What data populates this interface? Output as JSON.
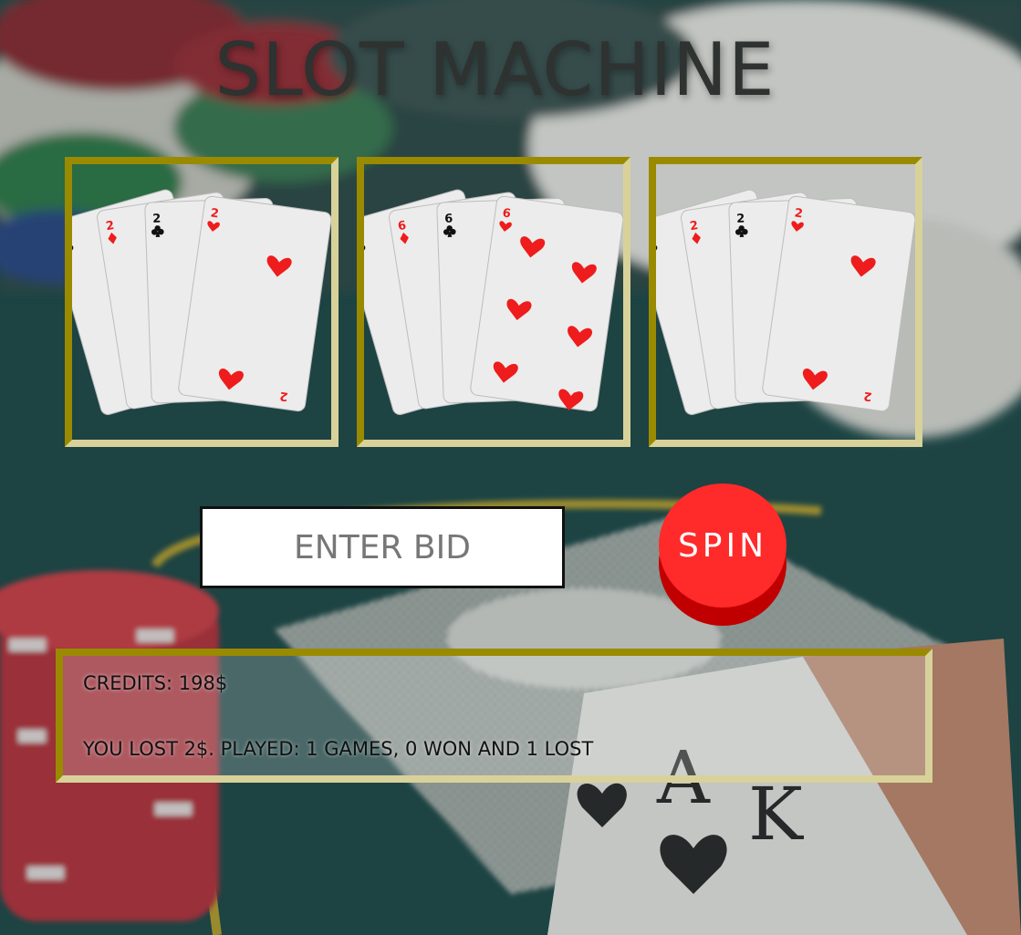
{
  "title": "SLOT MACHINE",
  "colors": {
    "frame_dark": "#9a8a00",
    "frame_light": "#d8d29a",
    "spin": "#ff2a2a",
    "spin_shade": "#c00000",
    "felt": "#1f4a4a"
  },
  "reels": [
    {
      "rank": "2",
      "suits": [
        "club",
        "diamond",
        "club",
        "heart"
      ]
    },
    {
      "rank": "6",
      "suits": [
        "club",
        "diamond",
        "club",
        "heart"
      ]
    },
    {
      "rank": "2",
      "suits": [
        "club",
        "diamond",
        "club",
        "heart"
      ]
    }
  ],
  "bid": {
    "placeholder": "ENTER BID",
    "value": ""
  },
  "spin_label": "SPIN",
  "credits_text": "CREDITS: 198$",
  "status_text": "YOU LOST 2$. PLAYED: 1 GAMES, 0 WON AND 1 LOST"
}
